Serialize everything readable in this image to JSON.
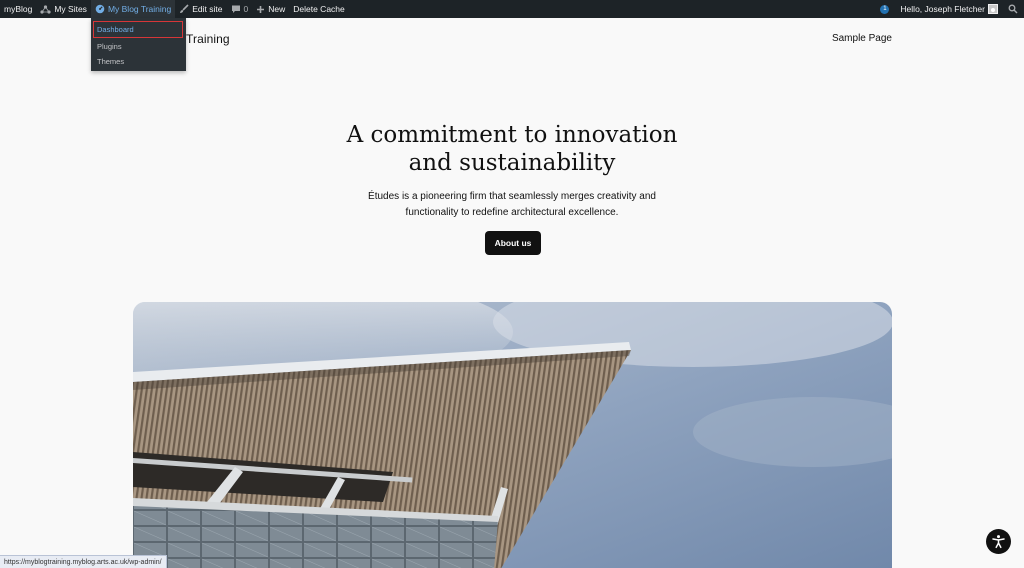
{
  "adminbar": {
    "brand": "myBlog",
    "my_sites": "My Sites",
    "current_site": "My Blog Training",
    "edit_site": "Edit site",
    "comments_count": "0",
    "new_label": "New",
    "delete_cache": "Delete Cache",
    "notification_count": "1",
    "greeting": "Hello, Joseph Fletcher"
  },
  "dropdown": {
    "items": [
      {
        "label": "Dashboard"
      },
      {
        "label": "Plugins"
      },
      {
        "label": "Themes"
      }
    ]
  },
  "site": {
    "title_visible": "Training",
    "nav_link": "Sample Page"
  },
  "hero": {
    "title_line1": "A commitment to innovation",
    "title_line2": "and sustainability",
    "desc_line1": "Études is a pioneering firm that seamlessly merges creativity and",
    "desc_line2": "functionality to redefine architectural excellence.",
    "button_label": "About us"
  },
  "status_url": "https://myblogtraining.myblog.arts.ac.uk/wp-admin/",
  "colors": {
    "adminbar_bg": "#1d2327",
    "adminbar_active": "#72aee6",
    "dropdown_bg": "#2c3338",
    "highlight_border": "#d63638",
    "page_bg": "#f9f9f9",
    "button_bg": "#111111"
  },
  "icons": [
    "network-icon",
    "speedometer-icon",
    "brush-icon",
    "comment-icon",
    "plus-icon",
    "search-icon",
    "accessibility-icon"
  ]
}
